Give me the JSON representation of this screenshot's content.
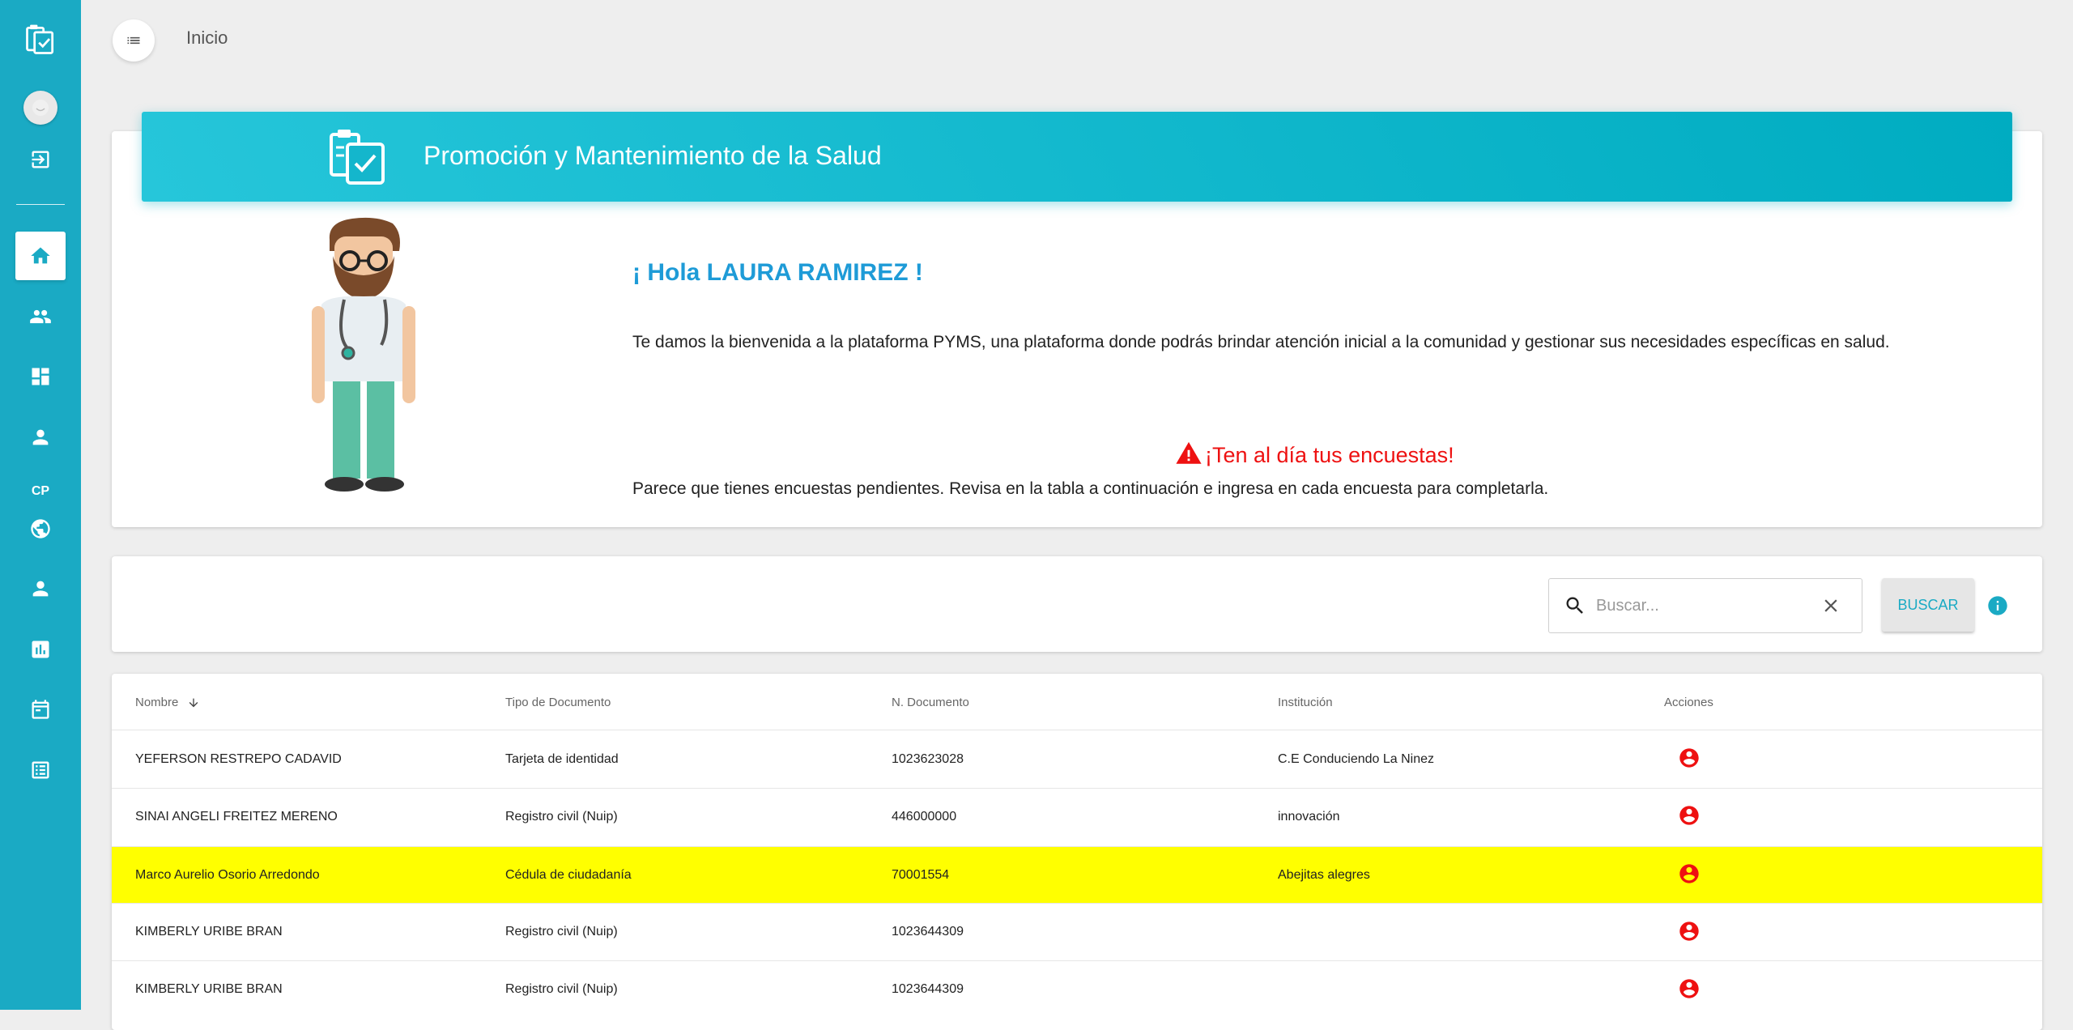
{
  "topbar": {
    "title": "Inicio"
  },
  "sidebar": {
    "items": [
      {
        "name": "logo",
        "icon": "survey-clipboard-icon"
      },
      {
        "name": "avatar",
        "icon": "avatar-icon"
      },
      {
        "name": "logout",
        "icon": "logout-icon"
      },
      {
        "name": "home",
        "icon": "home-icon",
        "active": true
      },
      {
        "name": "people",
        "icon": "people-icon"
      },
      {
        "name": "dashboard",
        "icon": "dashboard-icon"
      },
      {
        "name": "person",
        "icon": "person-icon"
      },
      {
        "name": "cp",
        "label": "CP"
      },
      {
        "name": "globe",
        "icon": "globe-icon"
      },
      {
        "name": "person-2",
        "icon": "person-icon"
      },
      {
        "name": "reports",
        "icon": "bar-chart-icon"
      },
      {
        "name": "calendar",
        "icon": "calendar-icon"
      },
      {
        "name": "list",
        "icon": "list-icon"
      }
    ]
  },
  "welcome": {
    "header_title": "Promoción y Mantenimiento de la Salud",
    "greeting": "¡ Hola LAURA RAMIREZ !",
    "intro": "Te damos la bienvenida a la plataforma PYMS, una plataforma donde podrás brindar atención inicial a la comunidad y gestionar sus necesidades específicas en salud.",
    "alert": "¡Ten al día tus encuestas!",
    "pending": "Parece que tienes encuestas pendientes. Revisa en la tabla a continuación e ingresa en cada encuesta para completarla."
  },
  "search": {
    "placeholder": "Buscar...",
    "value": "",
    "button_label": "BUSCAR"
  },
  "table": {
    "columns": [
      "Nombre",
      "Tipo de Documento",
      "N. Documento",
      "Institución",
      "Acciones"
    ],
    "rows": [
      {
        "nombre": "YEFERSON RESTREPO CADAVID",
        "tipo": "Tarjeta de identidad",
        "numero": "1023623028",
        "institucion": "C.E Conduciendo La Ninez",
        "highlighted": false
      },
      {
        "nombre": "SINAI ANGELI FREITEZ MERENO",
        "tipo": "Registro civil (Nuip)",
        "numero": "446000000",
        "institucion": "innovación",
        "highlighted": false
      },
      {
        "nombre": "Marco Aurelio Osorio Arredondo",
        "tipo": "Cédula de ciudadanía",
        "numero": "70001554",
        "institucion": "Abejitas alegres",
        "highlighted": true
      },
      {
        "nombre": "KIMBERLY URIBE BRAN",
        "tipo": "Registro civil (Nuip)",
        "numero": "1023644309",
        "institucion": "",
        "highlighted": false
      },
      {
        "nombre": "KIMBERLY URIBE BRAN",
        "tipo": "Registro civil (Nuip)",
        "numero": "1023644309",
        "institucion": "",
        "highlighted": false
      }
    ]
  },
  "colors": {
    "sidebar": "#1aaac4",
    "header_gradient_start": "#26c6da",
    "header_gradient_end": "#00acc1",
    "greeting": "#1e9bd7",
    "alert": "#ee1111",
    "row_highlight": "#ffff00"
  }
}
